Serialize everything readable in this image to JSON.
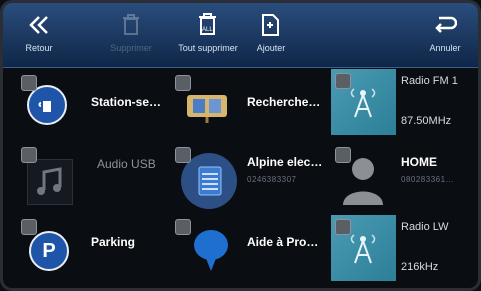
{
  "toolbar": {
    "back_label": "Retour",
    "delete_label": "Supprimer",
    "delete_all_label": "Tout supprimer",
    "add_label": "Ajouter",
    "cancel_label": "Annuler"
  },
  "shortcuts": [
    {
      "label": "Station-se…",
      "subtitle": "",
      "icon": "fuel-icon"
    },
    {
      "label": "Recherche…",
      "subtitle": "",
      "icon": "map-search-icon"
    },
    {
      "label": "Radio FM 1",
      "subtitle": "87.50MHz",
      "icon": "radio-tower-icon"
    },
    {
      "label": "Audio USB",
      "subtitle": "",
      "icon": "music-note-icon"
    },
    {
      "label": "Alpine elec…",
      "subtitle": "0246383307",
      "icon": "contact-book-icon"
    },
    {
      "label": "HOME",
      "subtitle": "080283361…",
      "icon": "person-icon"
    },
    {
      "label": "Parking",
      "subtitle": "",
      "icon": "parking-icon"
    },
    {
      "label": "Aide à Pro…",
      "subtitle": "",
      "icon": "speech-bubble-icon"
    },
    {
      "label": "Radio LW",
      "subtitle": "216kHz",
      "icon": "radio-tower-icon"
    }
  ],
  "colors": {
    "toolbar_top": "#2a4d7d",
    "toolbar_bottom": "#0f2647",
    "accent_blue": "#1f55a8",
    "radio_tile": "#3a8fa8"
  }
}
